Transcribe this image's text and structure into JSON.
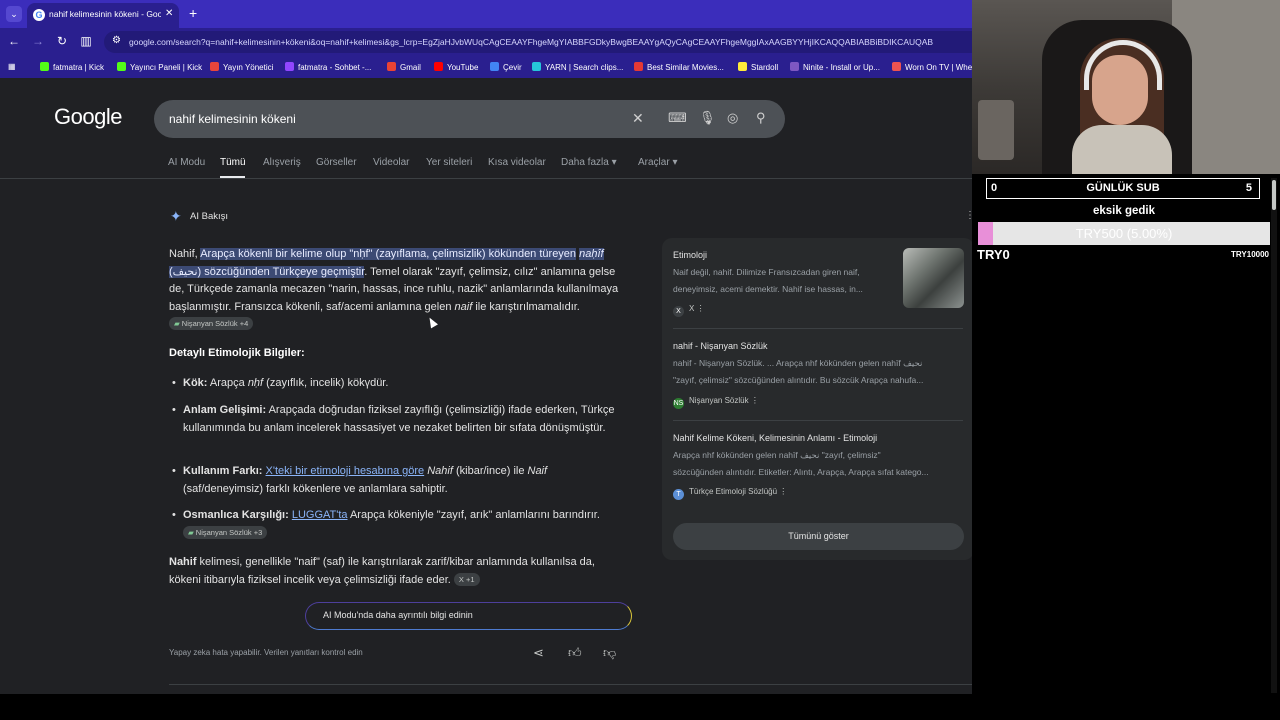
{
  "browser": {
    "tab_title": "nahif kelimesinin kökeni - Google",
    "tab_favicon": "G",
    "new_tab": "+",
    "url": "google.com/search?q=nahif+kelimesinin+kökeni&oq=nahif+kelimesi&gs_lcrp=EgZjaHJvbWUqCAgCEAAYFhgeMgYIABBFGDkyBwgBEAAYgAQyCAgCEAAYFhgeMggIAxAAGBYYHjIKCAQQABIABBiBDIKCAUQAB",
    "bookmarks": [
      "fatmatra | Kick",
      "Yayıncı Paneli | Kick",
      "Yayın Yönetici",
      "fatmatra - Sohbet -...",
      "Gmail",
      "YouTube",
      "Çevir",
      "YARN | Search clips...",
      "Best Similar Movies...",
      "Stardoll",
      "Ninite - Install or Up...",
      "Worn On TV | Wher"
    ]
  },
  "google": {
    "logo": "Google",
    "query": "nahif kelimesinin kökeni",
    "tabs": [
      "AI Modu",
      "Tümü",
      "Alışveriş",
      "Görseller",
      "Videolar",
      "Yer siteleri",
      "Kısa videolar",
      "Daha fazla ▾",
      "Araçlar ▾"
    ],
    "ai_title": "AI Bakışı",
    "intro": {
      "p1": "Nahif, ",
      "hl1": "Arapça kökenli bir kelime olup \"nḥf\" (zayıflama, çelimsizlik) kökünden türeyen",
      "hl2_italic": "naḥîf",
      "hl2": " (نحيف) sözcüğünden Türkçeye geçmiştir",
      "p2": ". Temel olarak \"zayıf, çelimsiz, cılız\" anlamına gelse de, Türkçede zamanla mecazen \"narin, hassas, ince ruhlu, nazik\" anlamlarında kullanılmaya başlanmıştır. Fransızca kökenli, saf/acemi anlamına gelen ",
      "naif": "naif",
      "p3": " ile karıştırılmamalıdır.",
      "chip": "Nişanyan Sözlük +4"
    },
    "section_title": "Detaylı Etimolojik Bilgiler:",
    "bullets": {
      "b1_label": "Kök:",
      "b1_text_a": " Arapça ",
      "b1_italic": "nḥf",
      "b1_text_b": " (zayıflık, incelik) kökүdür.",
      "b2_label": "Anlam Gelişimi:",
      "b2_text": " Arapçada doğrudan fiziksel zayıflığı (çelimsizliği) ifade ederken, Türkçe kullanımında bu anlam incelerek hassasiyet ve nezaket belirten bir sıfata dönüşmüştür.",
      "b3_label": "Kullanım Farkı:",
      "b3_link": "X'teki bir etimoloji hesabına göre",
      "b3_i1": "Nahif",
      "b3_t1": " (kibar/ince) ile ",
      "b3_i2": "Naif",
      "b3_t2": " (saf/deneyimsiz) farklı kökenlere ve anlamlara sahiptir.",
      "b4_label": "Osmanlıca Karşılığı:",
      "b4_link": "LUGGAT'ta",
      "b4_text": " Arapça kökeniyle \"zayıf, arık\" anlamlarını barındırır.",
      "b4_chip": "Nişanyan Sözlük +3"
    },
    "conclusion": {
      "bold": "Nahif",
      "text": " kelimesi, genellikle \"naif\" (saf) ile karıştırılarak zarif/kibar anlamında kullanılsa da, kökeni itibarıyla fiziksel incelik veya çelimsizliği ifade eder.",
      "chip": "X +1"
    },
    "ai_mode_button": "AI Modu'nda daha ayrıntılı bilgi edinin",
    "disclaimer": "Yapay zeka hata yapabilir. Verilen yanıtları kontrol edin"
  },
  "sources": [
    {
      "title": "Etimoloji",
      "snippet1": "Naif değil, nahif. Dilimize Fransızcadan giren naif,",
      "snippet2": "deneyimsiz, acemi demektir. Nahif ise hassas, in...",
      "site": "X",
      "site_icon": "X"
    },
    {
      "title": "nahif - Nişanyan Sözlük",
      "snippet1": "nahif - Nişanyan Sözlük. ... Arapça nhf kökünden gelen nahīf نحيف",
      "snippet2": "\"zayıf, çelimsiz\" sözcüğünden alıntıdır. Bu sözcük Arapça nahufa...",
      "site": "Nişanyan Sözlük",
      "site_icon": "NS"
    },
    {
      "title": "Nahif Kelime Kökeni, Kelimesinin Anlamı - Etimoloji",
      "snippet1": "Arapça nhf kökünden gelen nahīf نحيف \"zayıf, çelimsiz\"",
      "snippet2": "sözcüğünden alıntıdır. Etiketler: Alıntı, Arapça, Arapça sıfat katego...",
      "site": "Türkçe Etimoloji Sözlüğü",
      "site_icon": "T"
    }
  ],
  "show_all": "Tümünü göster",
  "overlay": {
    "sub_left": "0",
    "sub_title": "GÜNLÜK SUB",
    "sub_right": "5",
    "goal_title": "eksik gedik",
    "goal_text": "TRY500 (5.00%)",
    "goal_progress": 0.05,
    "goal_min": "TRY0",
    "goal_max": "TRY10000"
  },
  "colors": {
    "browser_chrome": "#3b2dbb",
    "page_bg": "#202124",
    "highlight": "#3c4a74",
    "link": "#8ab4f8",
    "goal_fill": "#e88fd8"
  }
}
